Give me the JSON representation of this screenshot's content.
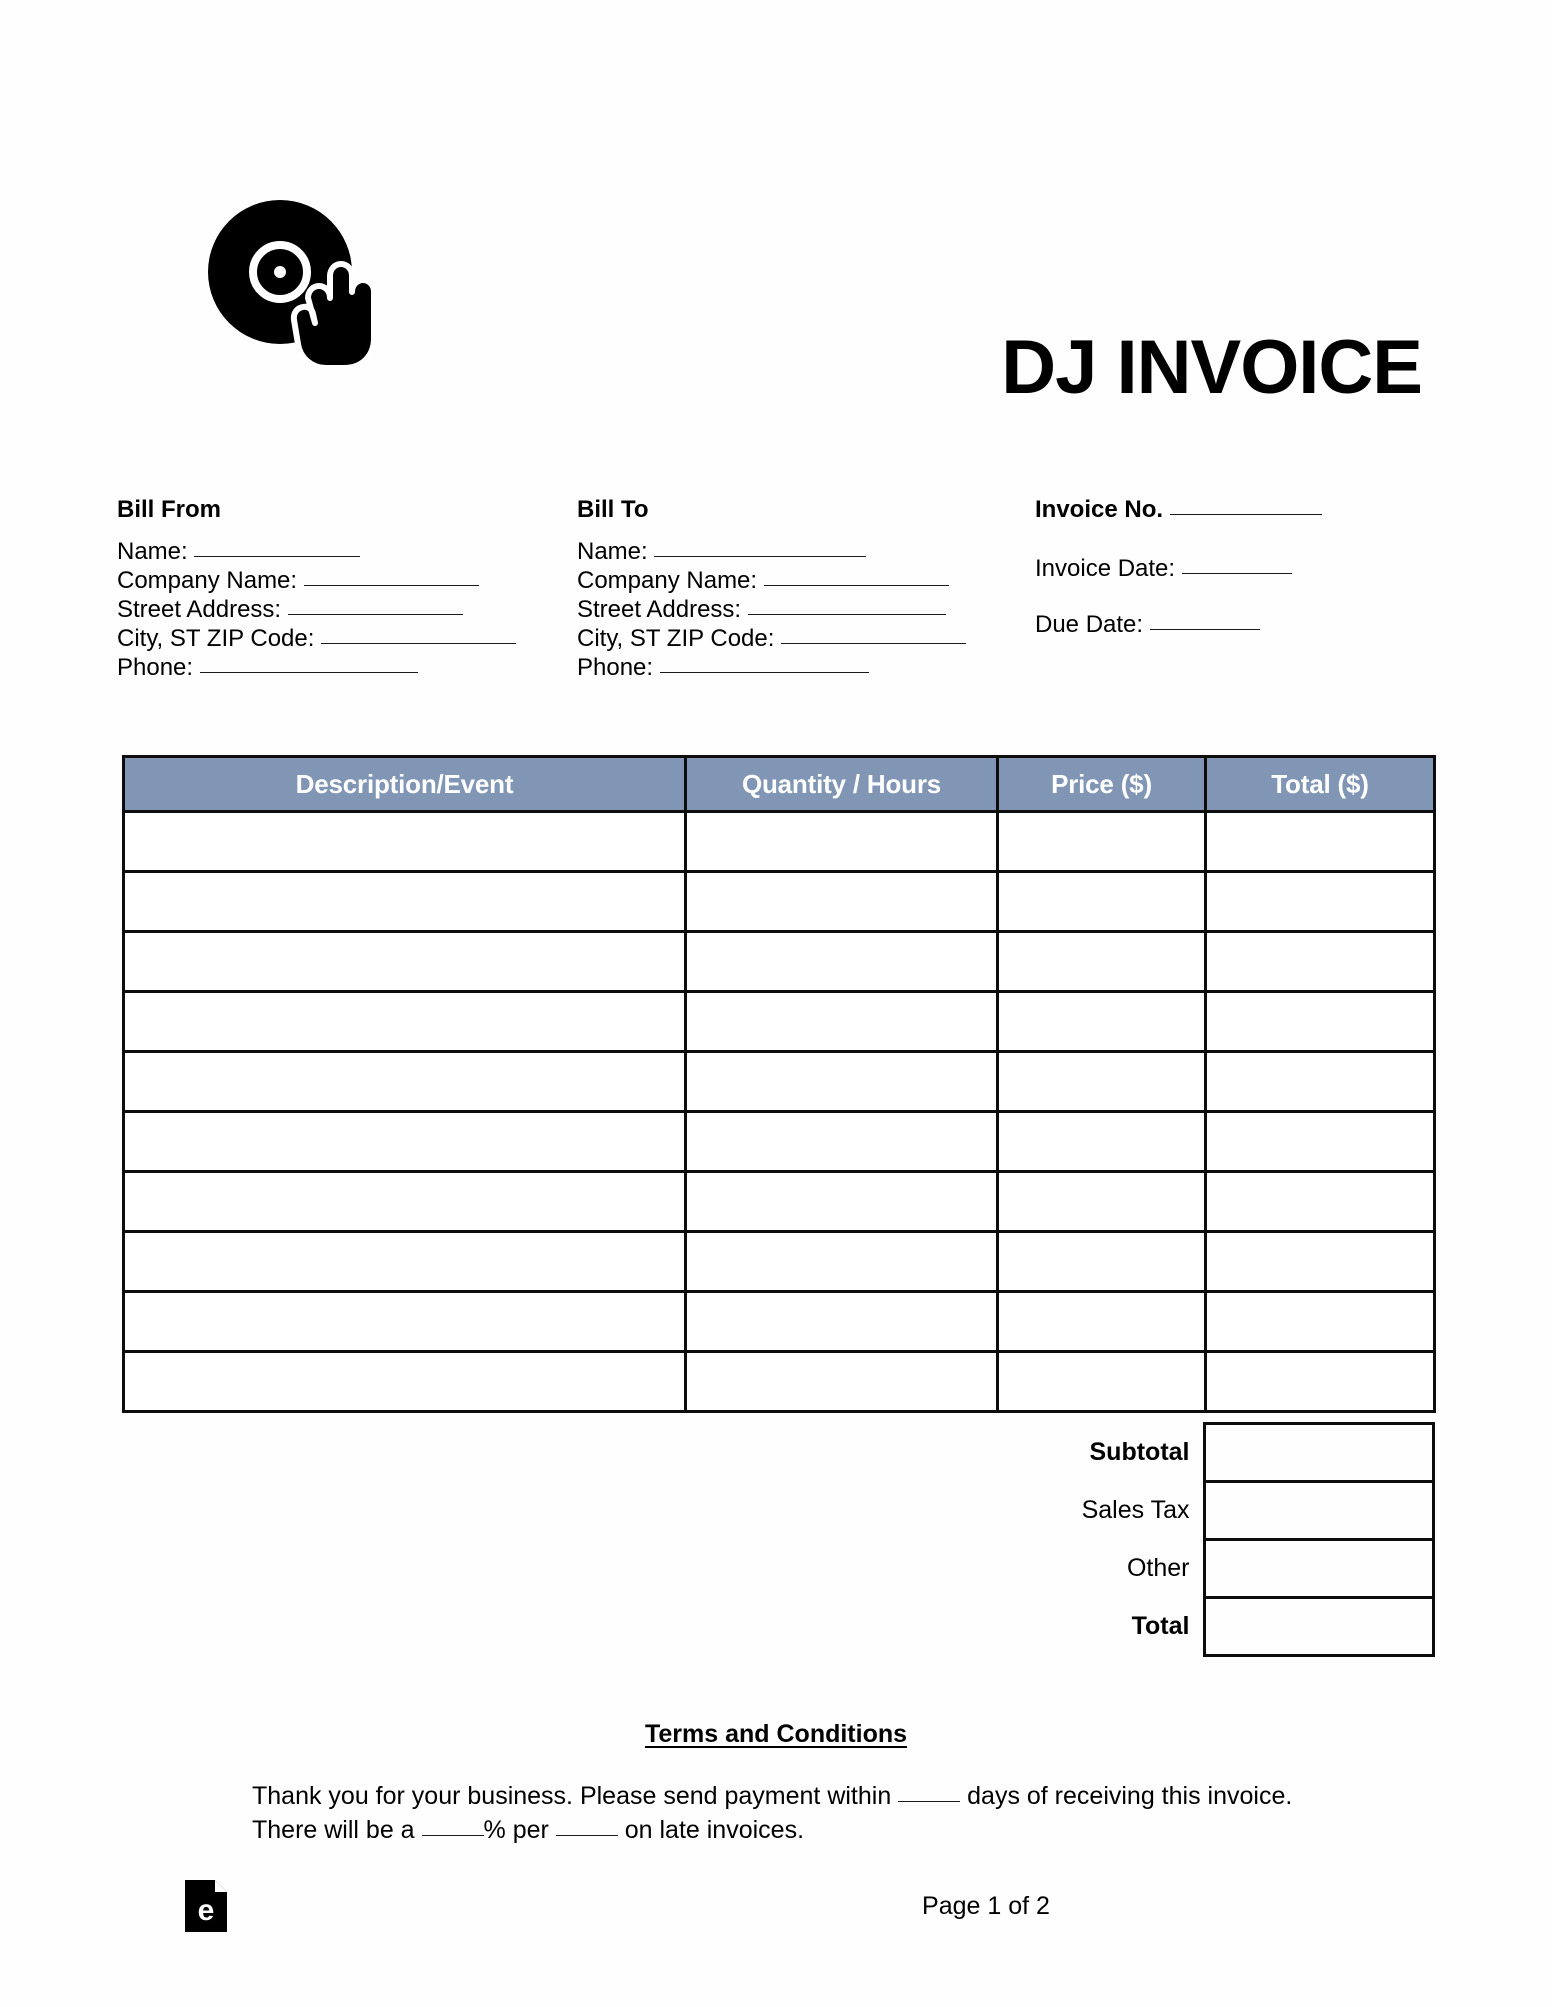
{
  "document": {
    "title": "DJ INVOICE",
    "logo_icon": "vinyl-record-hand-icon"
  },
  "bill_from": {
    "heading": "Bill From",
    "fields": [
      {
        "label": "Name:",
        "blank_width": 166
      },
      {
        "label": "Company Name:",
        "blank_width": 175
      },
      {
        "label": "Street Address:",
        "blank_width": 175
      },
      {
        "label": "City, ST ZIP Code:",
        "blank_width": 195
      },
      {
        "label": "Phone:",
        "blank_width": 218
      }
    ]
  },
  "bill_to": {
    "heading": "Bill To",
    "fields": [
      {
        "label": "Name:",
        "blank_width": 212
      },
      {
        "label": "Company Name:",
        "blank_width": 185
      },
      {
        "label": "Street Address:",
        "blank_width": 198
      },
      {
        "label": "City, ST ZIP Code:",
        "blank_width": 185
      },
      {
        "label": "Phone:",
        "blank_width": 209
      }
    ]
  },
  "invoice_meta": {
    "invoice_no_label": "Invoice No.",
    "invoice_no_blank_width": 152,
    "invoice_date_label": "Invoice Date:",
    "invoice_date_blank_width": 110,
    "due_date_label": "Due Date:",
    "due_date_blank_width": 110
  },
  "items_table": {
    "columns": [
      "Description/Event",
      "Quantity / Hours",
      "Price ($)",
      "Total ($)"
    ],
    "row_count": 10,
    "rows": [
      [
        "",
        "",
        "",
        ""
      ],
      [
        "",
        "",
        "",
        ""
      ],
      [
        "",
        "",
        "",
        ""
      ],
      [
        "",
        "",
        "",
        ""
      ],
      [
        "",
        "",
        "",
        ""
      ],
      [
        "",
        "",
        "",
        ""
      ],
      [
        "",
        "",
        "",
        ""
      ],
      [
        "",
        "",
        "",
        ""
      ],
      [
        "",
        "",
        "",
        ""
      ],
      [
        "",
        "",
        "",
        ""
      ]
    ],
    "header_bg": "#8196b4",
    "header_text_color": "#ffffff",
    "border_color": "#0d0d0d"
  },
  "totals": [
    {
      "label": "Subtotal",
      "value": "",
      "bold": true
    },
    {
      "label": "Sales Tax",
      "value": "",
      "bold": false
    },
    {
      "label": "Other",
      "value": "",
      "bold": false
    },
    {
      "label": "Total",
      "value": "",
      "bold": true
    }
  ],
  "terms": {
    "heading": "Terms and Conditions",
    "text_part_1": "Thank you for your business. Please send payment within ",
    "text_part_2": " days of receiving this invoice. There will be a ",
    "text_part_3": "% per ",
    "text_part_4": " on late invoices."
  },
  "footer": {
    "brand_icon": "eforms-document-icon",
    "brand_letter": "e",
    "page_label": "Page 1 of 2"
  }
}
